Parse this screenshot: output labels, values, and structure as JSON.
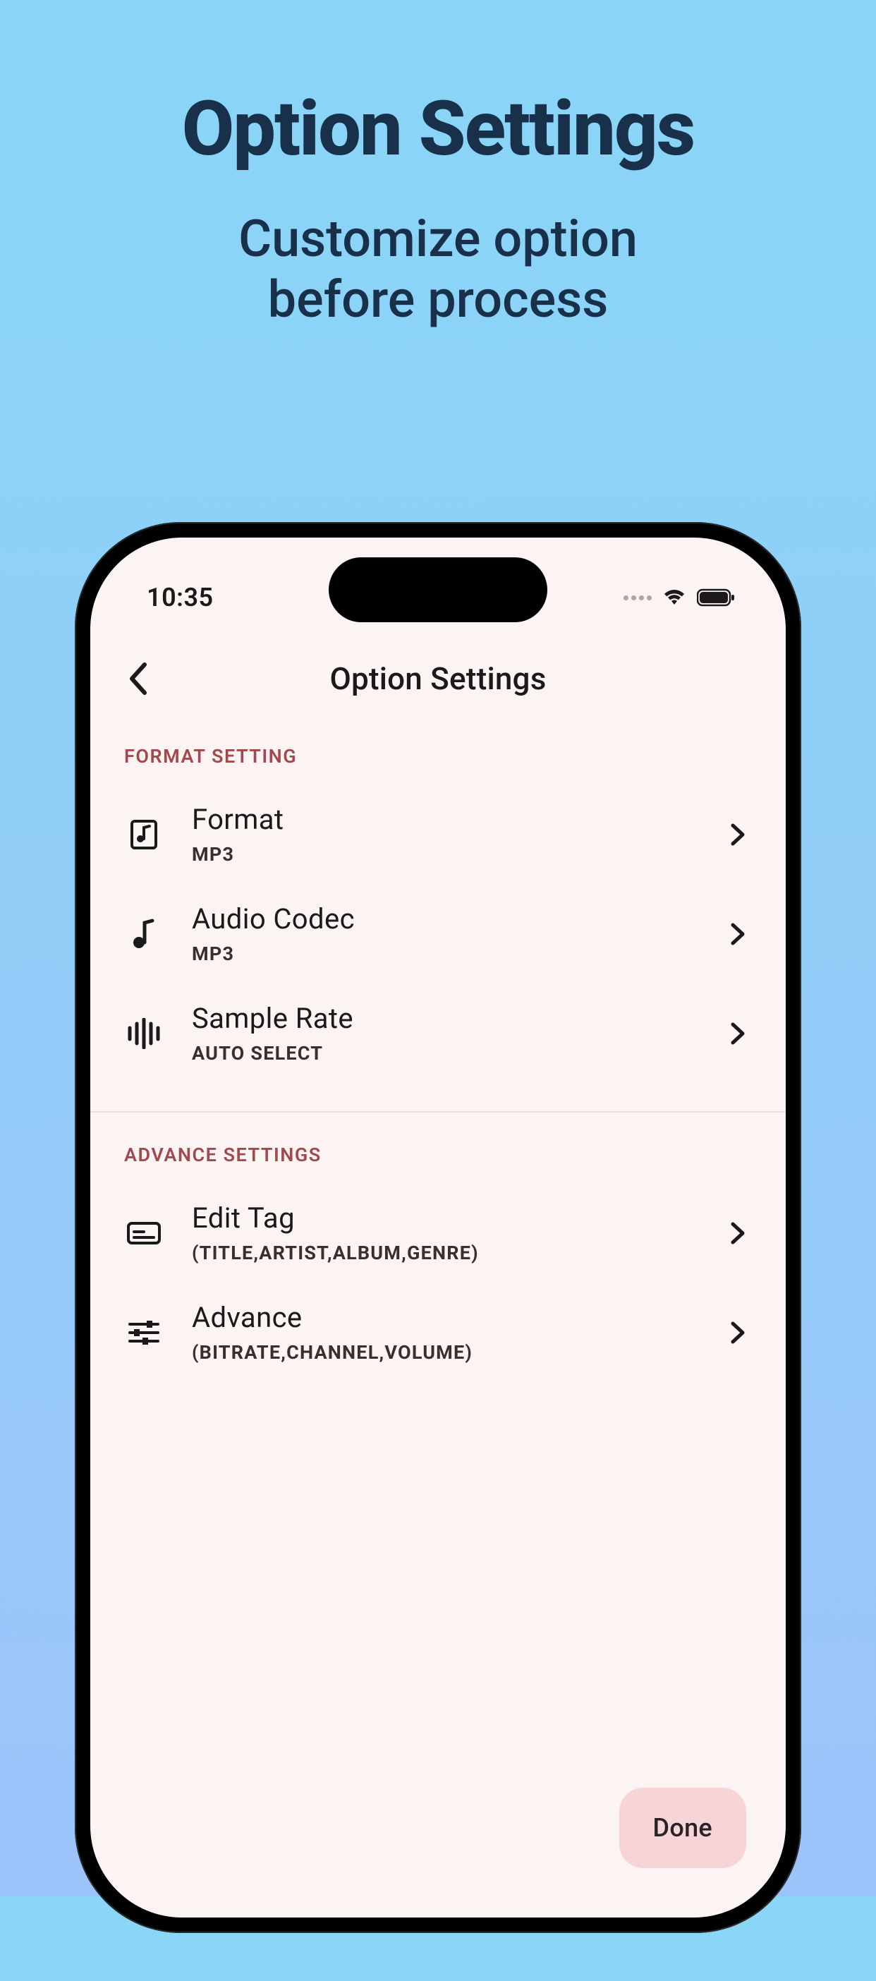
{
  "promo": {
    "title": "Option Settings",
    "subtitle_line1": "Customize option",
    "subtitle_line2": "before process"
  },
  "status": {
    "time": "10:35"
  },
  "nav": {
    "title": "Option Settings"
  },
  "sections": {
    "format": {
      "label": "FORMAT SETTING",
      "rows": {
        "format": {
          "title": "Format",
          "value": "MP3"
        },
        "codec": {
          "title": "Audio Codec",
          "value": "MP3"
        },
        "sample_rate": {
          "title": "Sample Rate",
          "value": "AUTO SELECT"
        }
      }
    },
    "advance": {
      "label": "ADVANCE SETTINGS",
      "rows": {
        "edit_tag": {
          "title": "Edit Tag",
          "value": "(TITLE,ARTIST,ALBUM,GENRE)"
        },
        "advance": {
          "title": "Advance",
          "value": "(BITRATE,CHANNEL,VOLUME)"
        }
      }
    }
  },
  "buttons": {
    "done": "Done"
  }
}
